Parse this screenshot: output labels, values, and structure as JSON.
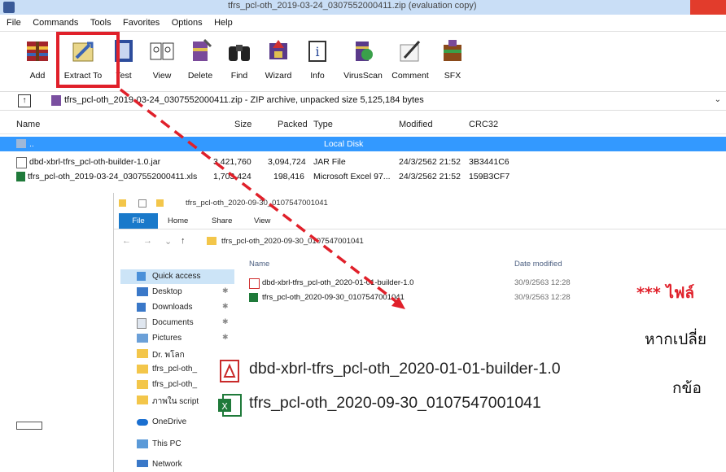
{
  "window": {
    "title": "tfrs_pcl-oth_2019-03-24_0307552000411.zip (evaluation copy)"
  },
  "menu": [
    "File",
    "Commands",
    "Tools",
    "Favorites",
    "Options",
    "Help"
  ],
  "toolbar": [
    "Add",
    "Extract To",
    "Test",
    "View",
    "Delete",
    "Find",
    "Wizard",
    "Info",
    "VirusScan",
    "Comment",
    "SFX"
  ],
  "address": {
    "path": "tfrs_pcl-oth_2019-03-24_0307552000411.zip - ZIP archive, unpacked size 5,125,184 bytes"
  },
  "columns": [
    "Name",
    "Size",
    "Packed",
    "Type",
    "Modified",
    "CRC32"
  ],
  "files": [
    {
      "name": "..",
      "size": "",
      "packed": "",
      "type": "Local Disk",
      "modified": "",
      "crc": ""
    },
    {
      "name": "dbd-xbrl-tfrs_pcl-oth-builder-1.0.jar",
      "size": "3,421,760",
      "packed": "3,094,724",
      "type": "JAR File",
      "modified": "24/3/2562 21:52",
      "crc": "3B3441C6"
    },
    {
      "name": "tfrs_pcl-oth_2019-03-24_0307552000411.xls",
      "size": "1,703,424",
      "packed": "198,416",
      "type": "Microsoft Excel 97...",
      "modified": "24/3/2562 21:52",
      "crc": "159B3CF7"
    }
  ],
  "explorer": {
    "title": "tfrs_pcl-oth_2020-09-30_0107547001041",
    "ribbon_tabs": [
      "File",
      "Home",
      "Share",
      "View"
    ],
    "path": "tfrs_pcl-oth_2020-09-30_0107547001041",
    "nav": [
      {
        "label": "Quick access",
        "pin": false
      },
      {
        "label": "Desktop",
        "pin": true
      },
      {
        "label": "Downloads",
        "pin": true
      },
      {
        "label": "Documents",
        "pin": true
      },
      {
        "label": "Pictures",
        "pin": true
      },
      {
        "label": "Dr. พโลก",
        "pin": false
      },
      {
        "label": "tfrs_pcl-oth_",
        "pin": false
      },
      {
        "label": "tfrs_pcl-oth_",
        "pin": false
      },
      {
        "label": "ภาพใน script",
        "pin": false
      },
      {
        "label": "OneDrive",
        "pin": false
      },
      {
        "label": "This PC",
        "pin": false
      },
      {
        "label": "Network",
        "pin": false
      }
    ],
    "columns": [
      "Name",
      "Date modified"
    ],
    "files": [
      {
        "name": "dbd-xbrl-tfrs_pcl-oth_2020-01-01-builder-1.0",
        "date": "30/9/2563 12:28"
      },
      {
        "name": "tfrs_pcl-oth_2020-09-30_0107547001041",
        "date": "30/9/2563 12:28"
      }
    ]
  },
  "zoom": {
    "files": [
      "dbd-xbrl-tfrs_pcl-oth_2020-01-01-builder-1.0",
      "tfrs_pcl-oth_2020-09-30_0107547001041"
    ]
  },
  "annotation": {
    "line1": "*** ไฟล์",
    "line2": "หากเปลี่ย",
    "line3": "กข้อ"
  }
}
